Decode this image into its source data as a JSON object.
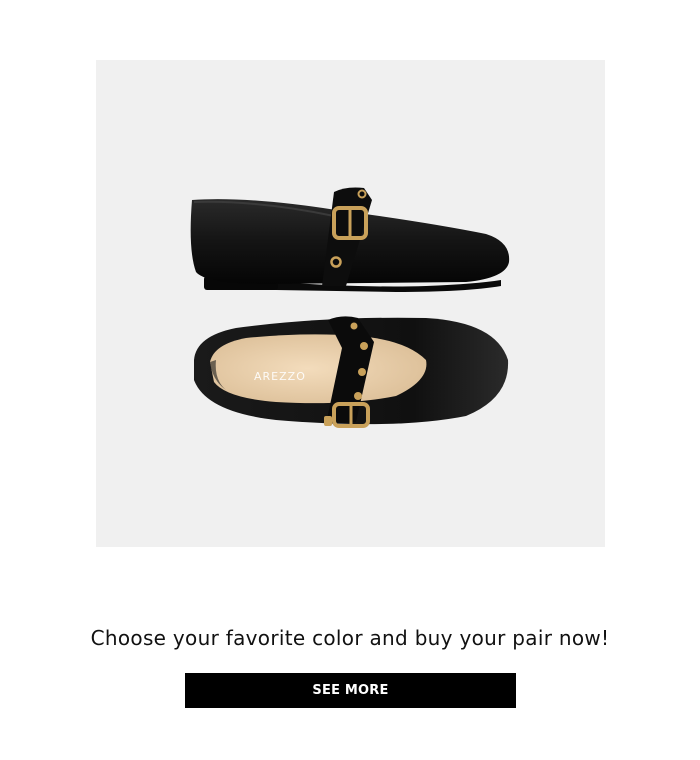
{
  "product": {
    "brand_imprint": "AREZZO",
    "colors": {
      "background": "#f0f0f0",
      "leather": "#121212",
      "insole": "#ecd2b0",
      "hardware": "#c9a15a"
    }
  },
  "tagline": "Choose your favorite color and buy your pair now!",
  "cta": {
    "label": "SEE MORE",
    "background": "#000000",
    "text_color": "#ffffff"
  }
}
